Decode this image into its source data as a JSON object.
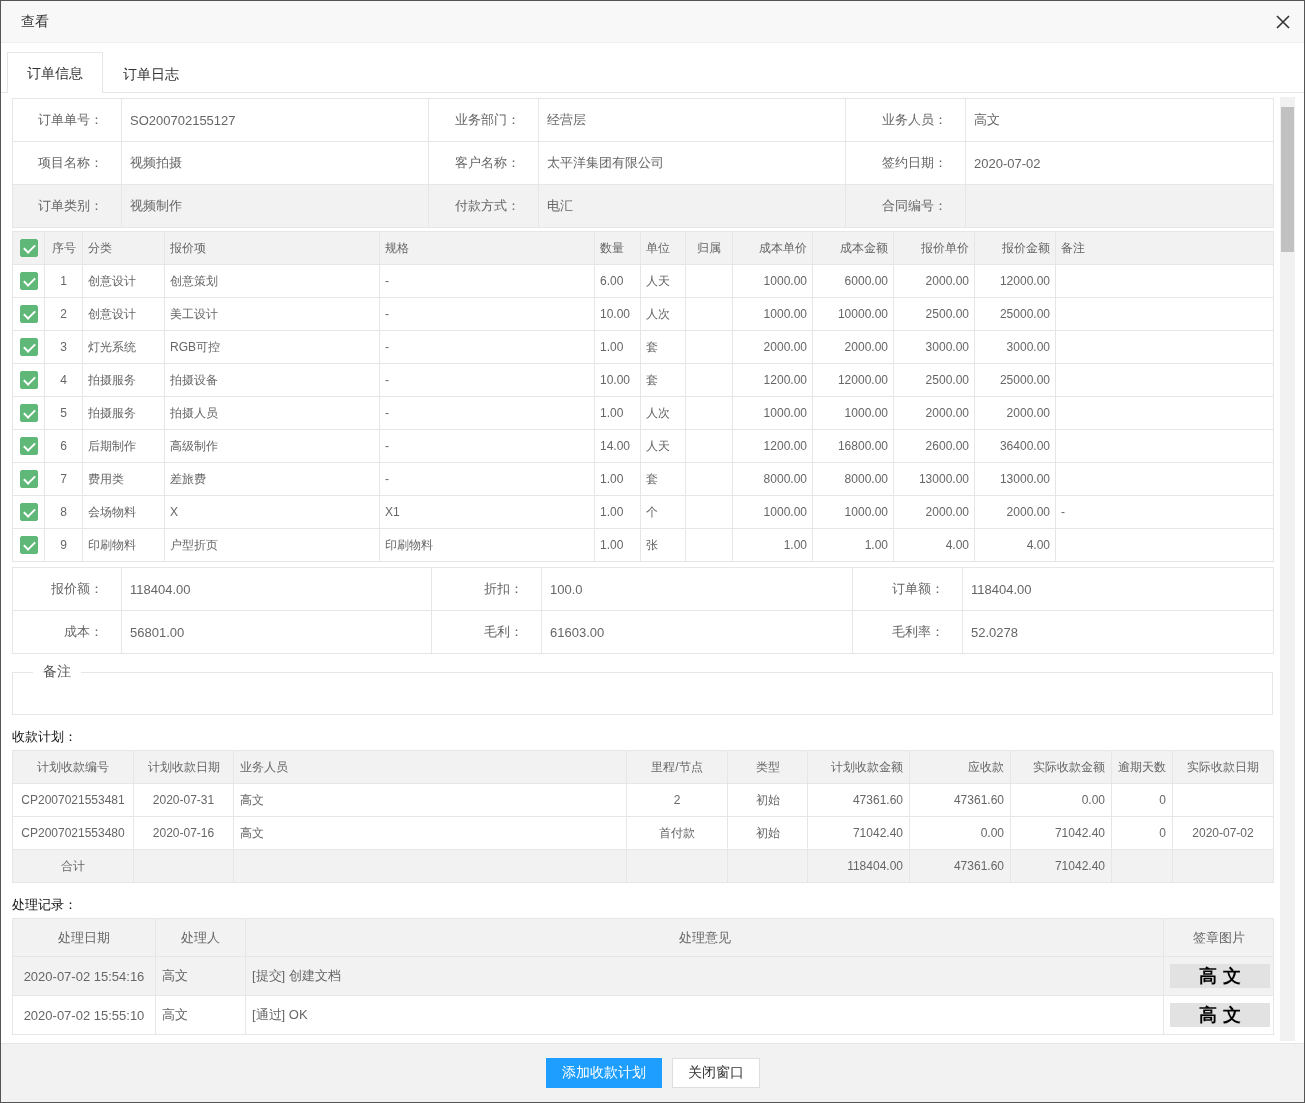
{
  "window": {
    "title": "查看"
  },
  "tabs": [
    {
      "label": "订单信息",
      "selected": true
    },
    {
      "label": "订单日志",
      "selected": false
    }
  ],
  "order_info": [
    {
      "label": "订单单号：",
      "value": "SO200702155127"
    },
    {
      "label": "业务部门：",
      "value": "经营层"
    },
    {
      "label": "业务人员：",
      "value": "高文"
    },
    {
      "label": "项目名称：",
      "value": "视频拍摄"
    },
    {
      "label": "客户名称：",
      "value": "太平洋集团有限公司"
    },
    {
      "label": "签约日期：",
      "value": "2020-07-02"
    },
    {
      "label": "订单类别：",
      "value": "视频制作"
    },
    {
      "label": "付款方式：",
      "value": "电汇"
    },
    {
      "label": "合同编号："
    }
  ],
  "items_table": {
    "all_checked": true,
    "columns": [
      "序号",
      "分类",
      "报价项",
      "规格",
      "数量",
      "单位",
      "归属",
      "成本单价",
      "成本金额",
      "报价单价",
      "报价金额",
      "备注"
    ],
    "rows": [
      {
        "checked": true,
        "no": "1",
        "category": "创意设计",
        "item": "创意策划",
        "spec": "-",
        "qty": "6.00",
        "unit": "人天",
        "cost_price": "1000.00",
        "cost_amount": "6000.00",
        "quote_price": "2000.00",
        "quote_amount": "12000.00"
      },
      {
        "checked": true,
        "no": "2",
        "category": "创意设计",
        "item": "美工设计",
        "spec": "-",
        "qty": "10.00",
        "unit": "人次",
        "cost_price": "1000.00",
        "cost_amount": "10000.00",
        "quote_price": "2500.00",
        "quote_amount": "25000.00"
      },
      {
        "checked": true,
        "no": "3",
        "category": "灯光系统",
        "item": "RGB可控",
        "spec": "-",
        "qty": "1.00",
        "unit": "套",
        "cost_price": "2000.00",
        "cost_amount": "2000.00",
        "quote_price": "3000.00",
        "quote_amount": "3000.00"
      },
      {
        "checked": true,
        "no": "4",
        "category": "拍摄服务",
        "item": "拍摄设备",
        "spec": "-",
        "qty": "10.00",
        "unit": "套",
        "cost_price": "1200.00",
        "cost_amount": "12000.00",
        "quote_price": "2500.00",
        "quote_amount": "25000.00"
      },
      {
        "checked": true,
        "no": "5",
        "category": "拍摄服务",
        "item": "拍摄人员",
        "spec": "-",
        "qty": "1.00",
        "unit": "人次",
        "cost_price": "1000.00",
        "cost_amount": "1000.00",
        "quote_price": "2000.00",
        "quote_amount": "2000.00"
      },
      {
        "checked": true,
        "no": "6",
        "category": "后期制作",
        "item": "高级制作",
        "spec": "-",
        "qty": "14.00",
        "unit": "人天",
        "cost_price": "1200.00",
        "cost_amount": "16800.00",
        "quote_price": "2600.00",
        "quote_amount": "36400.00"
      },
      {
        "checked": true,
        "no": "7",
        "category": "费用类",
        "item": "差旅费",
        "spec": "-",
        "qty": "1.00",
        "unit": "套",
        "cost_price": "8000.00",
        "cost_amount": "8000.00",
        "quote_price": "13000.00",
        "quote_amount": "13000.00"
      },
      {
        "checked": true,
        "no": "8",
        "category": "会场物料",
        "item": "X",
        "spec": "X1",
        "qty": "1.00",
        "unit": "个",
        "cost_price": "1000.00",
        "cost_amount": "1000.00",
        "quote_price": "2000.00",
        "quote_amount": "2000.00",
        "remark": "-"
      },
      {
        "checked": true,
        "no": "9",
        "category": "印刷物料",
        "item": "户型折页",
        "spec": "印刷物料",
        "qty": "1.00",
        "unit": "张",
        "cost_price": "1.00",
        "cost_amount": "1.00",
        "quote_price": "4.00",
        "quote_amount": "4.00"
      }
    ]
  },
  "summary": [
    {
      "label": "报价额：",
      "value": "118404.00"
    },
    {
      "label": "折扣：",
      "value": "100.0"
    },
    {
      "label": "订单额：",
      "value": "118404.00"
    },
    {
      "label": "成本：",
      "value": "56801.00"
    },
    {
      "label": "毛利：",
      "value": "61603.00"
    },
    {
      "label": "毛利率：",
      "value": "52.0278"
    }
  ],
  "remark": {
    "legend": "备注"
  },
  "payment_plan": {
    "title": "收款计划：",
    "columns": [
      "计划收款编号",
      "计划收款日期",
      "业务人员",
      "里程/节点",
      "类型",
      "计划收款金额",
      "应收款",
      "实际收款金额",
      "逾期天数",
      "实际收款日期"
    ],
    "rows": [
      {
        "code": "CP2007021553481",
        "date": "2020-07-31",
        "person": "高文",
        "milestone": "2",
        "type": "初始",
        "planned": "47361.60",
        "receivable": "47361.60",
        "actual": "0.00",
        "overdue": "0"
      },
      {
        "code": "CP2007021553480",
        "date": "2020-07-16",
        "person": "高文",
        "milestone": "首付款",
        "type": "初始",
        "planned": "71042.40",
        "receivable": "0.00",
        "actual": "71042.40",
        "overdue": "0",
        "actual_date": "2020-07-02"
      }
    ],
    "total": {
      "label": "合计",
      "planned": "118404.00",
      "receivable": "47361.60",
      "actual": "71042.40"
    }
  },
  "records": {
    "title": "处理记录：",
    "columns": [
      "处理日期",
      "处理人",
      "处理意见",
      "签章图片"
    ],
    "rows": [
      {
        "date": "2020-07-02 15:54:16",
        "handler": "高文",
        "opinion": "[提交] 创建文档",
        "signature": "高 文"
      },
      {
        "date": "2020-07-02 15:55:10",
        "handler": "高文",
        "opinion": "[通过] OK",
        "signature": "高 文"
      }
    ]
  },
  "buttons": [
    {
      "label": "添加收款计划",
      "kind": "primary"
    },
    {
      "label": "关闭窗口",
      "kind": "default"
    }
  ]
}
